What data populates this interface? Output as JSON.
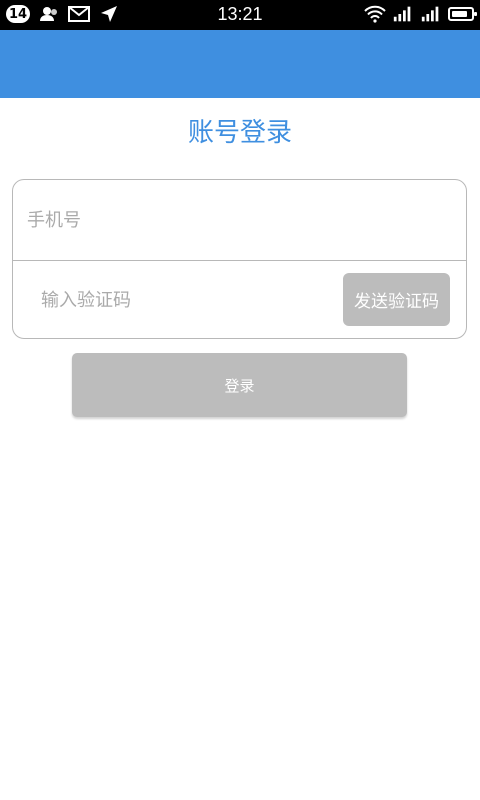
{
  "status_bar": {
    "notification_count": "14",
    "time": "13:21",
    "icons": [
      "contacts-icon",
      "mail-icon",
      "location-arrow-icon",
      "wifi-icon",
      "signal-icon",
      "signal-icon",
      "battery-icon"
    ]
  },
  "page": {
    "title": "账号登录"
  },
  "form": {
    "phone_placeholder": "手机号",
    "code_placeholder": "输入验证码",
    "send_code_label": "发送验证码"
  },
  "login": {
    "label": "登录"
  },
  "colors": {
    "accent": "#3f8fe0",
    "button_disabled": "#bcbcbc",
    "border": "#b8b8b8"
  }
}
